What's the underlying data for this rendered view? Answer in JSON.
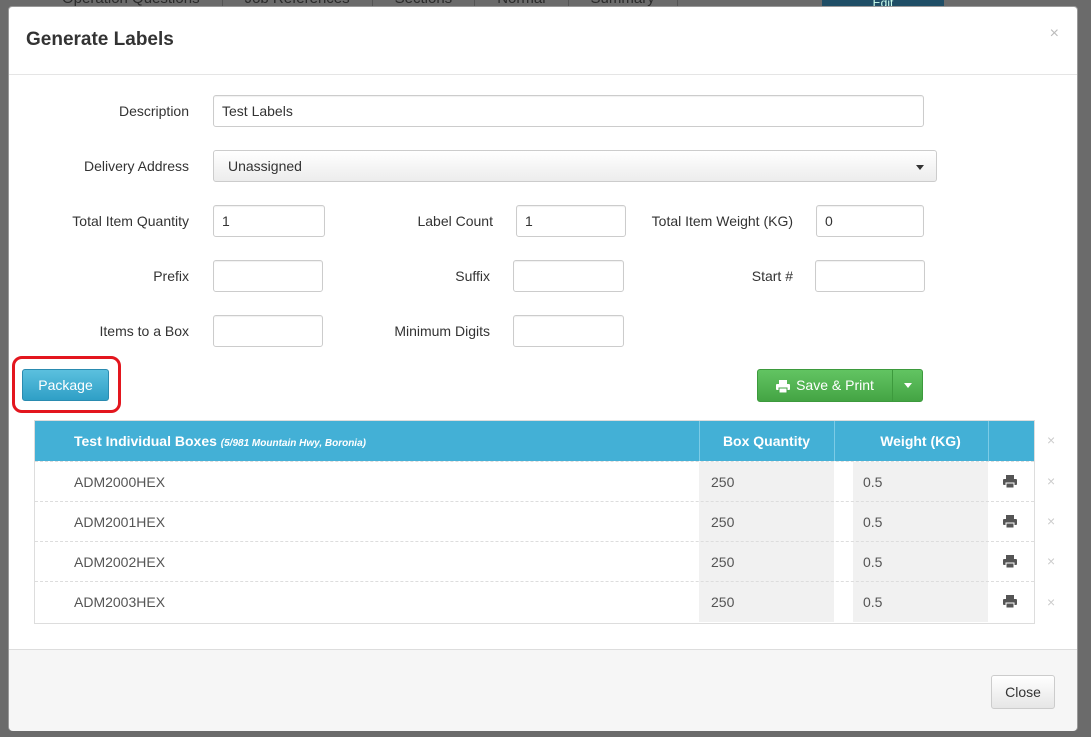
{
  "background": {
    "tabs": [
      "Operation Questions",
      "Job References",
      "Sections",
      "Normal",
      "Summary"
    ],
    "edit_button": "Edit"
  },
  "modal": {
    "title": "Generate Labels",
    "close_x": "×",
    "fields": {
      "description": {
        "label": "Description",
        "value": "Test Labels"
      },
      "delivery_address": {
        "label": "Delivery Address",
        "value": "Unassigned"
      },
      "total_item_quantity": {
        "label": "Total Item Quantity",
        "value": "1"
      },
      "label_count": {
        "label": "Label Count",
        "value": "1"
      },
      "total_item_weight": {
        "label": "Total Item Weight (KG)",
        "value": "0"
      },
      "prefix": {
        "label": "Prefix",
        "value": ""
      },
      "suffix": {
        "label": "Suffix",
        "value": ""
      },
      "start_number": {
        "label": "Start #",
        "value": ""
      },
      "items_to_a_box": {
        "label": "Items to a Box",
        "value": ""
      },
      "minimum_digits": {
        "label": "Minimum Digits",
        "value": ""
      }
    },
    "package_button": "Package",
    "save_print_button": "Save & Print",
    "table": {
      "header_title": "Test Individual Boxes",
      "header_address": "(5/981 Mountain Hwy, Boronia)",
      "col_box_quantity": "Box Quantity",
      "col_weight": "Weight (KG)",
      "header_x": "×",
      "rows": [
        {
          "code": "ADM2000HEX",
          "box_quantity": "250",
          "weight": "0.5",
          "x": "×"
        },
        {
          "code": "ADM2001HEX",
          "box_quantity": "250",
          "weight": "0.5",
          "x": "×"
        },
        {
          "code": "ADM2002HEX",
          "box_quantity": "250",
          "weight": "0.5",
          "x": "×"
        },
        {
          "code": "ADM2003HEX",
          "box_quantity": "250",
          "weight": "0.5",
          "x": "×"
        }
      ]
    },
    "footer_close_button": "Close"
  },
  "colors": {
    "package_button": "#2f9fc6",
    "save_button": "#44a444",
    "table_header": "#43b0d6",
    "highlight": "#e3161e"
  }
}
